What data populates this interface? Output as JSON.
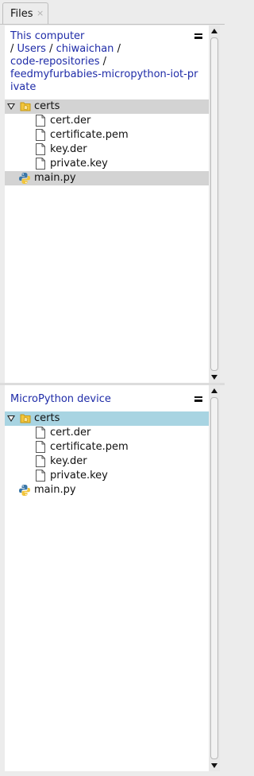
{
  "tab": {
    "label": "Files",
    "close": "×"
  },
  "computer": {
    "breadcrumb": {
      "root": "This computer",
      "sep": "/",
      "parts": [
        "Users",
        "chiwaichan",
        "code-repositories",
        "feedmyfurbabies-micropython-iot-private"
      ]
    },
    "tree": {
      "folder": "certs",
      "files": [
        "cert.der",
        "certificate.pem",
        "key.der",
        "private.key"
      ],
      "script": "main.py"
    }
  },
  "device": {
    "title": "MicroPython device",
    "tree": {
      "folder": "certs",
      "files": [
        "cert.der",
        "certificate.pem",
        "key.der",
        "private.key"
      ],
      "script": "main.py"
    }
  },
  "colors": {
    "link": "#1f2ca8",
    "selection_gray": "#d3d3d3",
    "selection_blue": "#a8d4e2",
    "folder_yellow": "#f2c53b"
  },
  "icons": {
    "menu": "hamburger-menu-icon",
    "expand": "triangle-down-icon",
    "folder": "folder-icon",
    "file": "document-icon",
    "python": "python-file-icon"
  }
}
